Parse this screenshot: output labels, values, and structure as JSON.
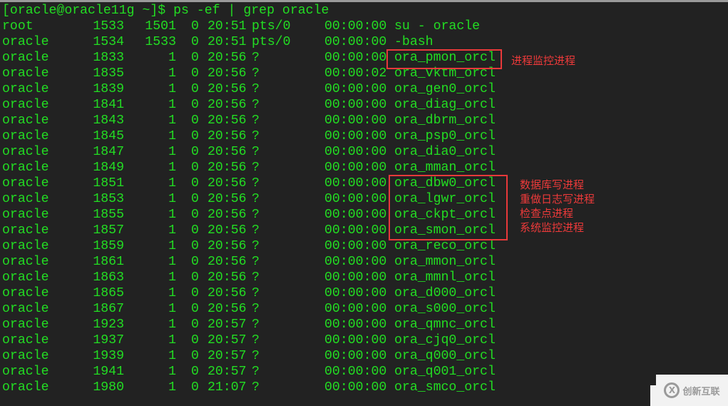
{
  "terminal": {
    "prompt": "[oracle@oracle11g ~]$ ps -ef | grep oracle",
    "rows": [
      {
        "user": "root",
        "pid": "1533",
        "ppid": "1501",
        "c": "0",
        "stime": "20:51",
        "tty": "pts/0",
        "time": "00:00:00",
        "cmd": "su - oracle"
      },
      {
        "user": "oracle",
        "pid": "1534",
        "ppid": "1533",
        "c": "0",
        "stime": "20:51",
        "tty": "pts/0",
        "time": "00:00:00",
        "cmd": "-bash"
      },
      {
        "user": "oracle",
        "pid": "1833",
        "ppid": "1",
        "c": "0",
        "stime": "20:56",
        "tty": "?",
        "time": "00:00:00",
        "cmd": "ora_pmon_orcl"
      },
      {
        "user": "oracle",
        "pid": "1835",
        "ppid": "1",
        "c": "0",
        "stime": "20:56",
        "tty": "?",
        "time": "00:00:02",
        "cmd": "ora_vktm_orcl"
      },
      {
        "user": "oracle",
        "pid": "1839",
        "ppid": "1",
        "c": "0",
        "stime": "20:56",
        "tty": "?",
        "time": "00:00:00",
        "cmd": "ora_gen0_orcl"
      },
      {
        "user": "oracle",
        "pid": "1841",
        "ppid": "1",
        "c": "0",
        "stime": "20:56",
        "tty": "?",
        "time": "00:00:00",
        "cmd": "ora_diag_orcl"
      },
      {
        "user": "oracle",
        "pid": "1843",
        "ppid": "1",
        "c": "0",
        "stime": "20:56",
        "tty": "?",
        "time": "00:00:00",
        "cmd": "ora_dbrm_orcl"
      },
      {
        "user": "oracle",
        "pid": "1845",
        "ppid": "1",
        "c": "0",
        "stime": "20:56",
        "tty": "?",
        "time": "00:00:00",
        "cmd": "ora_psp0_orcl"
      },
      {
        "user": "oracle",
        "pid": "1847",
        "ppid": "1",
        "c": "0",
        "stime": "20:56",
        "tty": "?",
        "time": "00:00:00",
        "cmd": "ora_dia0_orcl"
      },
      {
        "user": "oracle",
        "pid": "1849",
        "ppid": "1",
        "c": "0",
        "stime": "20:56",
        "tty": "?",
        "time": "00:00:00",
        "cmd": "ora_mman_orcl"
      },
      {
        "user": "oracle",
        "pid": "1851",
        "ppid": "1",
        "c": "0",
        "stime": "20:56",
        "tty": "?",
        "time": "00:00:00",
        "cmd": "ora_dbw0_orcl"
      },
      {
        "user": "oracle",
        "pid": "1853",
        "ppid": "1",
        "c": "0",
        "stime": "20:56",
        "tty": "?",
        "time": "00:00:00",
        "cmd": "ora_lgwr_orcl"
      },
      {
        "user": "oracle",
        "pid": "1855",
        "ppid": "1",
        "c": "0",
        "stime": "20:56",
        "tty": "?",
        "time": "00:00:00",
        "cmd": "ora_ckpt_orcl"
      },
      {
        "user": "oracle",
        "pid": "1857",
        "ppid": "1",
        "c": "0",
        "stime": "20:56",
        "tty": "?",
        "time": "00:00:00",
        "cmd": "ora_smon_orcl"
      },
      {
        "user": "oracle",
        "pid": "1859",
        "ppid": "1",
        "c": "0",
        "stime": "20:56",
        "tty": "?",
        "time": "00:00:00",
        "cmd": "ora_reco_orcl"
      },
      {
        "user": "oracle",
        "pid": "1861",
        "ppid": "1",
        "c": "0",
        "stime": "20:56",
        "tty": "?",
        "time": "00:00:00",
        "cmd": "ora_mmon_orcl"
      },
      {
        "user": "oracle",
        "pid": "1863",
        "ppid": "1",
        "c": "0",
        "stime": "20:56",
        "tty": "?",
        "time": "00:00:00",
        "cmd": "ora_mmnl_orcl"
      },
      {
        "user": "oracle",
        "pid": "1865",
        "ppid": "1",
        "c": "0",
        "stime": "20:56",
        "tty": "?",
        "time": "00:00:00",
        "cmd": "ora_d000_orcl"
      },
      {
        "user": "oracle",
        "pid": "1867",
        "ppid": "1",
        "c": "0",
        "stime": "20:56",
        "tty": "?",
        "time": "00:00:00",
        "cmd": "ora_s000_orcl"
      },
      {
        "user": "oracle",
        "pid": "1923",
        "ppid": "1",
        "c": "0",
        "stime": "20:57",
        "tty": "?",
        "time": "00:00:00",
        "cmd": "ora_qmnc_orcl"
      },
      {
        "user": "oracle",
        "pid": "1937",
        "ppid": "1",
        "c": "0",
        "stime": "20:57",
        "tty": "?",
        "time": "00:00:00",
        "cmd": "ora_cjq0_orcl"
      },
      {
        "user": "oracle",
        "pid": "1939",
        "ppid": "1",
        "c": "0",
        "stime": "20:57",
        "tty": "?",
        "time": "00:00:00",
        "cmd": "ora_q000_orcl"
      },
      {
        "user": "oracle",
        "pid": "1941",
        "ppid": "1",
        "c": "0",
        "stime": "20:57",
        "tty": "?",
        "time": "00:00:00",
        "cmd": "ora_q001_orcl"
      },
      {
        "user": "oracle",
        "pid": "1980",
        "ppid": "1",
        "c": "0",
        "stime": "21:07",
        "tty": "?",
        "time": "00:00:00",
        "cmd": "ora_smco_orcl"
      }
    ]
  },
  "annotations": {
    "pmon_note": "进程监控进程",
    "group_notes": [
      "数据库写进程",
      "重做日志写进程",
      "检查点进程",
      "系统监控进程"
    ],
    "color": "#e8393a"
  },
  "watermark": {
    "icon": "logo-icon",
    "icon_glyph": "X",
    "text": "创新互联"
  },
  "colors": {
    "terminal_text": "#22dd22",
    "terminal_bg": "#222222"
  }
}
